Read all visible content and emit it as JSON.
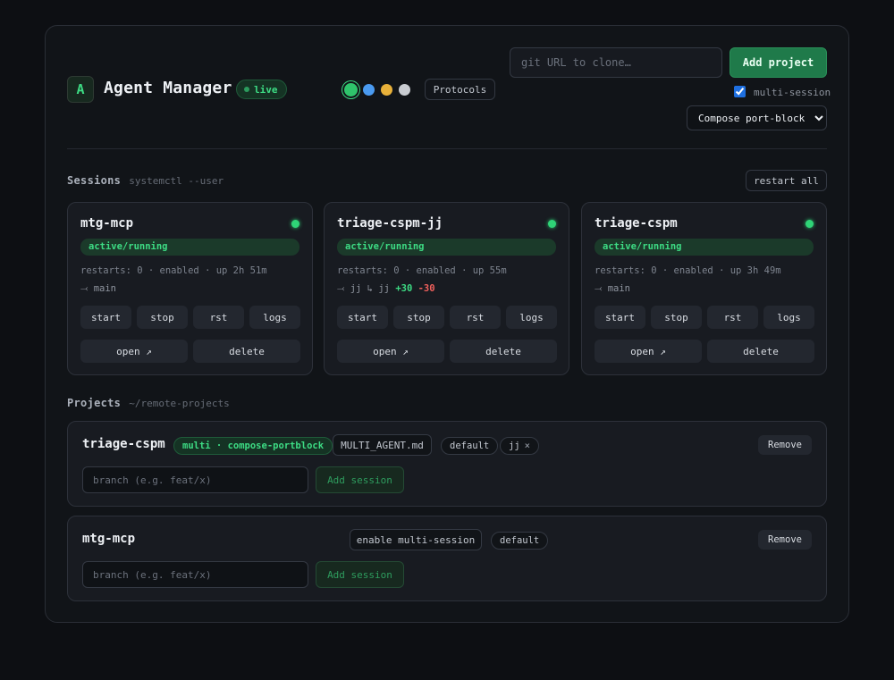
{
  "header": {
    "logo_letter": "A",
    "title": "Agent Manager",
    "live_badge": "live",
    "theme_colors": [
      "#2fc46b",
      "#4a9af0",
      "#e8b13a",
      "#c9ccd1"
    ],
    "protocols_label": "Protocols",
    "git_placeholder": "git URL to clone…",
    "add_project_label": "Add project",
    "multi_session_label": "multi-session",
    "multi_session_checked": true,
    "compose_option": "Compose port-block"
  },
  "sessions": {
    "title": "Sessions",
    "subtitle": "systemctl --user",
    "restart_all_label": "restart all",
    "cards": [
      {
        "name": "mtg-mcp",
        "state": "active/running",
        "meta": "restarts: 0 · enabled · up 2h 51m",
        "branch": "⤙ main",
        "diff_plus": "",
        "diff_minus": "",
        "actions": [
          "start",
          "stop",
          "rst",
          "logs"
        ],
        "open_label": "open ↗",
        "delete_label": "delete"
      },
      {
        "name": "triage-cspm-jj",
        "state": "active/running",
        "meta": "restarts: 0 · enabled · up 55m",
        "branch": "⤙ jj ↳ jj",
        "diff_plus": "+30",
        "diff_minus": "-30",
        "actions": [
          "start",
          "stop",
          "rst",
          "logs"
        ],
        "open_label": "open ↗",
        "delete_label": "delete"
      },
      {
        "name": "triage-cspm",
        "state": "active/running",
        "meta": "restarts: 0 · enabled · up 3h 49m",
        "branch": "⤙ main",
        "diff_plus": "",
        "diff_minus": "",
        "actions": [
          "start",
          "stop",
          "rst",
          "logs"
        ],
        "open_label": "open ↗",
        "delete_label": "delete"
      }
    ]
  },
  "projects": {
    "title": "Projects",
    "subtitle": "~/remote-projects",
    "items": [
      {
        "name": "triage-cspm",
        "mode_badge": "multi · compose-portblock",
        "agent_file": "MULTI_AGENT.md",
        "tag_default": "default",
        "tag_jj": "jj",
        "tag_jj_close": "×",
        "remove_label": "Remove",
        "branch_placeholder": "branch (e.g. feat/x)",
        "add_session_label": "Add session"
      },
      {
        "name": "mtg-mcp",
        "enable_multi_label": "enable multi-session",
        "tag_default": "default",
        "remove_label": "Remove",
        "branch_placeholder": "branch (e.g. feat/x)",
        "add_session_label": "Add session"
      }
    ]
  }
}
